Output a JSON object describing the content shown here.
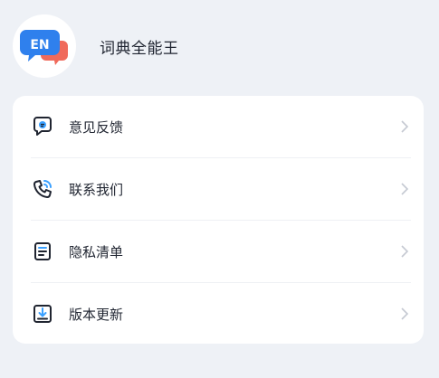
{
  "app": {
    "name": "词典全能王",
    "logo_text": "EN",
    "logo_colors": {
      "bubble": "#2f80ed",
      "accent": "#f06a5b"
    }
  },
  "menu": {
    "items": [
      {
        "label": "意见反馈",
        "icon": "feedback-chat-icon"
      },
      {
        "label": "联系我们",
        "icon": "contact-phone-icon"
      },
      {
        "label": "隐私清单",
        "icon": "privacy-list-icon"
      },
      {
        "label": "版本更新",
        "icon": "download-update-icon"
      }
    ]
  },
  "colors": {
    "background": "#eef1f6",
    "card": "#ffffff",
    "icon_dark": "#1f2430",
    "icon_accent": "#3aa0ff",
    "chevron": "#c5c9d2"
  }
}
